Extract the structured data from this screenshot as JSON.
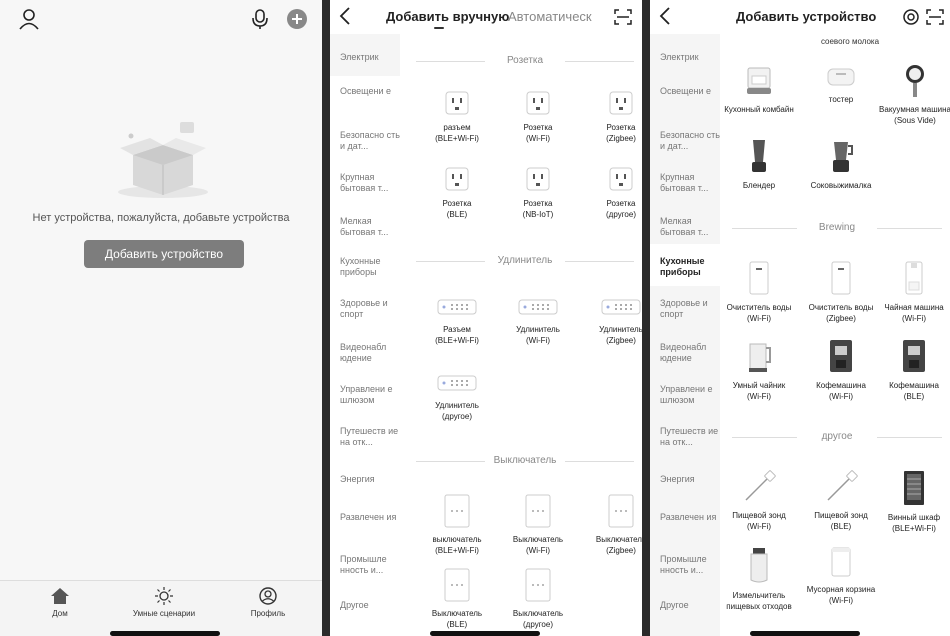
{
  "panel1": {
    "empty_message": "Нет устройства, пожалуйста, добавьте устройства",
    "add_button": "Добавить устройство",
    "tabs": [
      {
        "label": "Дом",
        "icon": "home-icon"
      },
      {
        "label": "Умные сценарии",
        "icon": "sun-icon"
      },
      {
        "label": "Профиль",
        "icon": "profile-icon"
      }
    ]
  },
  "panel2": {
    "tab_manual": "Добавить вручную",
    "tab_auto": "Автоматическ",
    "sidebar": [
      "Электрик",
      "Освещени е",
      "Безопасно сть и дат...",
      "Крупная бытовая т...",
      "Мелкая бытовая т...",
      "Кухонные приборы",
      "Здоровье и спорт",
      "Видеонабл юдение",
      "Управлени е шлюзом",
      "Путешеств ие на отк...",
      "Энергия",
      "Развлечен ия",
      "Промышле нность и...",
      "Другое"
    ],
    "sections": [
      {
        "title": "Розетка",
        "items": [
          [
            "разъем",
            "(BLE+Wi-Fi)"
          ],
          [
            "Розетка",
            "(Wi-Fi)"
          ],
          [
            "Розетка",
            "(Zigbee)"
          ],
          [
            "Розетка",
            "(BLE)"
          ],
          [
            "Розетка",
            "(NB-IoT)"
          ],
          [
            "Розетка",
            "(другое)"
          ]
        ]
      },
      {
        "title": "Удлинитель",
        "items": [
          [
            "Разъем",
            "(BLE+Wi-Fi)"
          ],
          [
            "Удлинитель",
            "(Wi-Fi)"
          ],
          [
            "Удлинитель",
            "(Zigbee)"
          ],
          [
            "Удлинитель",
            "(другое)"
          ]
        ]
      },
      {
        "title": "Выключатель",
        "items": [
          [
            "выключатель",
            "(BLE+Wi-Fi)"
          ],
          [
            "Выключатель",
            "(Wi-Fi)"
          ],
          [
            "Выключатель",
            "(Zigbee)"
          ],
          [
            "Выключатель",
            "(BLE)"
          ],
          [
            "Выключатель",
            "(другое)"
          ]
        ]
      }
    ]
  },
  "panel3": {
    "title": "Добавить устройство",
    "sidebar": [
      "Электрик",
      "Освещени е",
      "Безопасно сть и дат...",
      "Крупная бытовая т...",
      "Мелкая бытовая т...",
      "Кухонные приборы",
      "Здоровье и спорт",
      "Видеонабл юдение",
      "Управлени е шлюзом",
      "Путешеств ие на отк...",
      "Энергия",
      "Развлечен ия",
      "Промышле нность и...",
      "Другое"
    ],
    "top_cut_label": "соевого молока",
    "row1": [
      [
        "Кухонный комбайн",
        ""
      ],
      [
        "тостер",
        ""
      ],
      [
        "Вакуумная машина",
        "(Sous Vide)"
      ]
    ],
    "row2": [
      [
        "Блендер",
        ""
      ],
      [
        "Соковыжималка",
        ""
      ]
    ],
    "brewing_title": "Brewing",
    "brewing": [
      [
        "Очиститель воды",
        "(Wi-Fi)"
      ],
      [
        "Очиститель воды",
        "(Zigbee)"
      ],
      [
        "Чайная машина",
        "(Wi-Fi)"
      ],
      [
        "Умный чайник",
        "(Wi-Fi)"
      ],
      [
        "Кофемашина",
        "(Wi-Fi)"
      ],
      [
        "Кофемашина",
        "(BLE)"
      ]
    ],
    "other_title": "другое",
    "other": [
      [
        "Пищевой зонд",
        "(Wi-Fi)"
      ],
      [
        "Пищевой зонд",
        "(BLE)"
      ],
      [
        "Винный шкаф",
        "(BLE+Wi-Fi)"
      ],
      [
        "Измельчитель",
        "пищевых отходов"
      ],
      [
        "Мусорная корзина",
        "(Wi-Fi)"
      ]
    ]
  }
}
